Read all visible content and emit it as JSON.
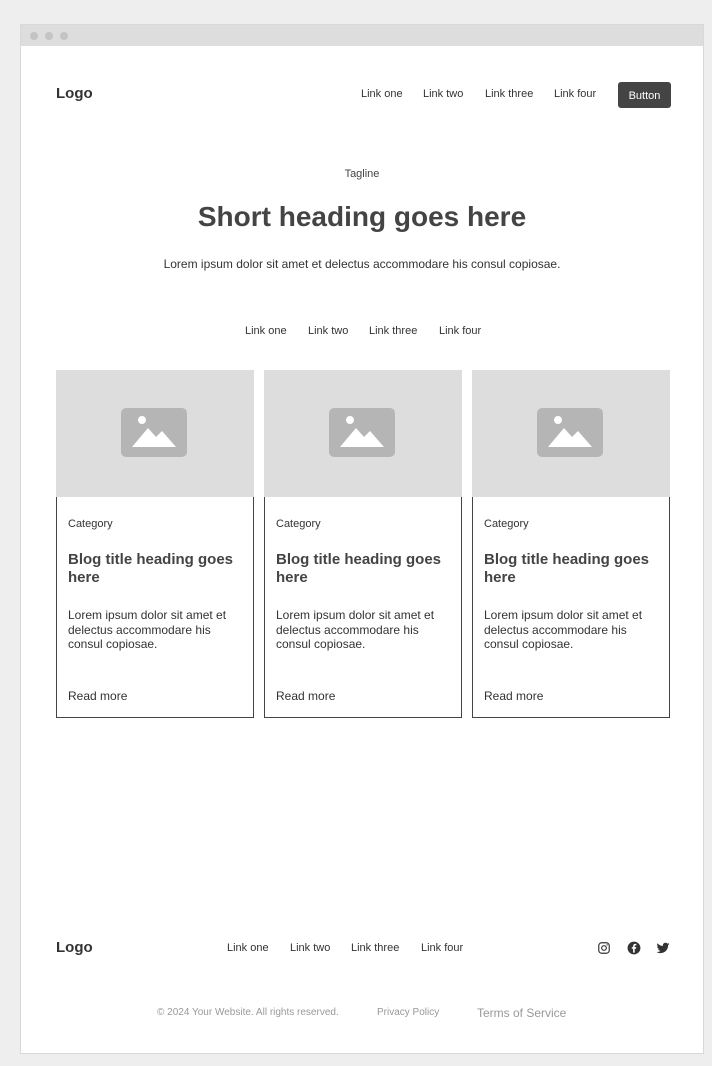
{
  "header": {
    "logo": "Logo",
    "nav": [
      "Link one",
      "Link two",
      "Link three",
      "Link four"
    ],
    "button_label": "Button"
  },
  "hero": {
    "tagline": "Tagline",
    "heading": "Short heading goes here",
    "text": "Lorem ipsum dolor sit amet et delectus accommodare his consul copiosae."
  },
  "filters": [
    "Link one",
    "Link two",
    "Link three",
    "Link four"
  ],
  "cards": [
    {
      "category": "Category",
      "title": "Blog title heading goes here",
      "text": "Lorem ipsum dolor sit amet et delectus accommodare his consul copiosae.",
      "link": "Read more",
      "image_icon": "image-placeholder-icon"
    },
    {
      "category": "Category",
      "title": "Blog title heading goes here",
      "text": "Lorem ipsum dolor sit amet et delectus accommodare his consul copiosae.",
      "link": "Read more",
      "image_icon": "image-placeholder-icon"
    },
    {
      "category": "Category",
      "title": "Blog title heading goes here",
      "text": "Lorem ipsum dolor sit amet et delectus accommodare his consul copiosae.",
      "link": "Read more",
      "image_icon": "image-placeholder-icon"
    }
  ],
  "footer": {
    "logo": "Logo",
    "nav": [
      "Link one",
      "Link two",
      "Link three",
      "Link four"
    ],
    "social_icons": [
      "instagram-icon",
      "facebook-icon",
      "twitter-icon"
    ],
    "copyright": "© 2024 Your Website. All rights reserved.",
    "privacy": "Privacy Policy",
    "terms": "Terms of Service"
  },
  "colors": {
    "page_bg": "#eeeeee",
    "titlebar": "#dddddd",
    "button_bg": "#444444",
    "placeholder_bg": "#dddddd",
    "placeholder_icon": "#b5b5b5"
  }
}
